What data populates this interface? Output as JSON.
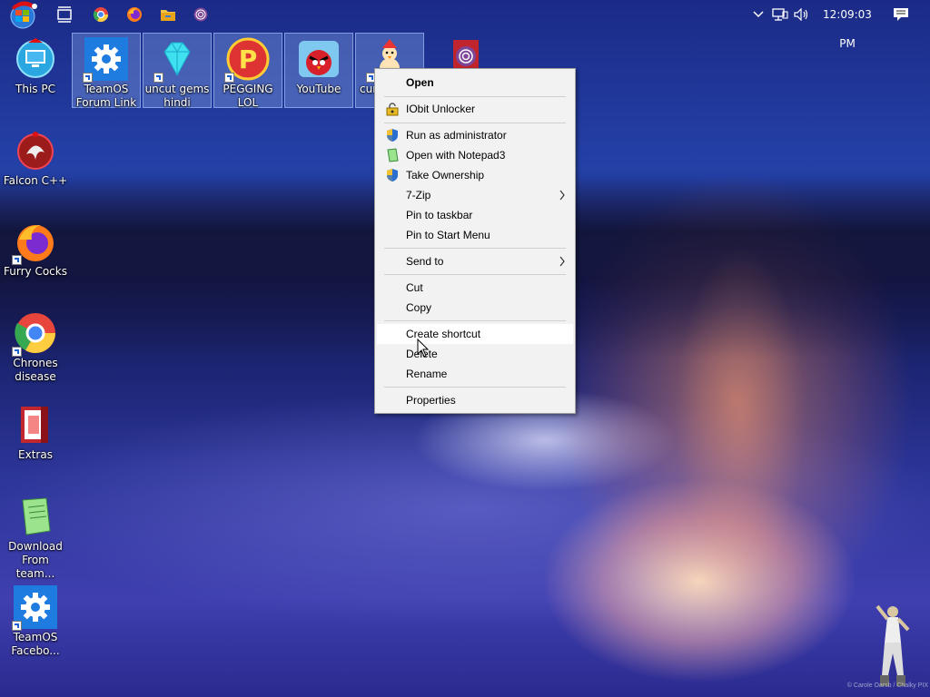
{
  "taskbar": {
    "clock": "12:09:03 PM",
    "pinned": [
      {
        "name": "task-view-icon",
        "color": "#ffffff"
      },
      {
        "name": "chrome-icon",
        "color": "#e8453c"
      },
      {
        "name": "firefox-icon",
        "color": "#ff7a1a"
      },
      {
        "name": "file-explorer-icon",
        "color": "#f4c542"
      },
      {
        "name": "tor-browser-icon",
        "color": "#7d4698"
      }
    ],
    "tray": [
      "chevron-up-icon",
      "network-icon",
      "volume-icon",
      "notifications-icon"
    ]
  },
  "desktop": {
    "left_column": [
      {
        "label": "This PC",
        "icon": "computer-icon"
      },
      {
        "label": "Falcon C++",
        "icon": "falcon-icon"
      },
      {
        "label": "Furry Cocks",
        "icon": "firefox-icon"
      },
      {
        "label": "Chrones disease",
        "icon": "chrome-icon"
      },
      {
        "label": "Extras",
        "icon": "folder-icon"
      },
      {
        "label": "Download From team...",
        "icon": "notepad-icon"
      },
      {
        "label": "TeamOS Facebo...",
        "icon": "gear-icon"
      }
    ],
    "top_row": [
      {
        "label": "TeamOS Forum Link",
        "icon": "gear-icon"
      },
      {
        "label": "uncut gems hindi",
        "icon": "diamond-icon"
      },
      {
        "label": "PEGGING LOL",
        "icon": "p-logo-icon"
      },
      {
        "label": "YouTube",
        "icon": "angry-bird-icon"
      },
      {
        "label": "cur",
        "icon": "snowman-icon"
      },
      {
        "label": "",
        "icon": "tor-browser-icon"
      }
    ]
  },
  "context_menu": {
    "items": {
      "open": "Open",
      "iobit": "IObit Unlocker",
      "run_admin": "Run as administrator",
      "notepad3": "Open with Notepad3",
      "take_ownership": "Take Ownership",
      "zip": "7-Zip",
      "pin_taskbar": "Pin to taskbar",
      "pin_start": "Pin to Start Menu",
      "send_to": "Send to",
      "cut": "Cut",
      "copy": "Copy",
      "create_shortcut": "Create shortcut",
      "delete": "Delete",
      "rename": "Rename",
      "properties": "Properties"
    },
    "submenu_arrow": ">"
  },
  "watermark": "© Carole Oarsb / Chalky PIX"
}
